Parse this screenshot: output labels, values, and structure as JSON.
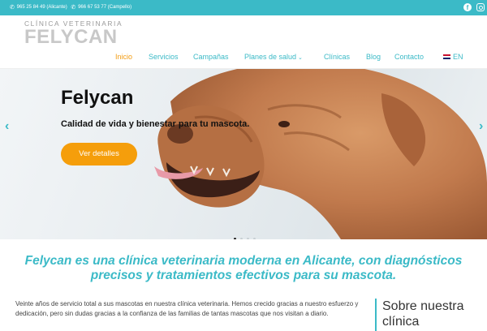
{
  "topbar": {
    "phone1": "965 25 84 49 (Alicante)",
    "phone2": "966 67 53 77 (Campello)",
    "social": [
      "facebook-icon",
      "instagram-icon"
    ]
  },
  "brand": {
    "tagline_small": "CLÍNICA VETERINARIA",
    "name": "FELYCAN"
  },
  "nav": {
    "items": [
      {
        "label": "Inicio",
        "active": true
      },
      {
        "label": "Servicios"
      },
      {
        "label": "Campañas"
      },
      {
        "label": "Planes de salud",
        "has_dropdown": true
      },
      {
        "label": "Clínicas"
      },
      {
        "label": "Blog"
      },
      {
        "label": "Contacto"
      },
      {
        "label": "EN",
        "icon": "uk-flag-icon"
      }
    ]
  },
  "hero": {
    "title": "Felycan",
    "subtitle": "Calidad de vida y bienestar para tu mascota.",
    "cta": "Ver detalles",
    "prev": "‹",
    "next": "›",
    "slides": 4,
    "active_slide": 1
  },
  "intro": {
    "tagline": "Felycan es una clínica veterinaria moderna en Alicante, con diagnósticos precisos y tratamientos efectivos para su mascota.",
    "text": "Veinte años de servicio total a sus mascotas en nuestra clínica veterinaria. Hemos crecido gracias a nuestro esfuerzo y dedicación, pero sin dudas gracias a la confianza de las familias de tantas mascotas que nos visitan a diario."
  },
  "sidebar": {
    "title": "Sobre nuestra clínica"
  },
  "colors": {
    "accent": "#3bbac7",
    "cta": "#f59e0b",
    "active_nav": "#f39c12"
  }
}
